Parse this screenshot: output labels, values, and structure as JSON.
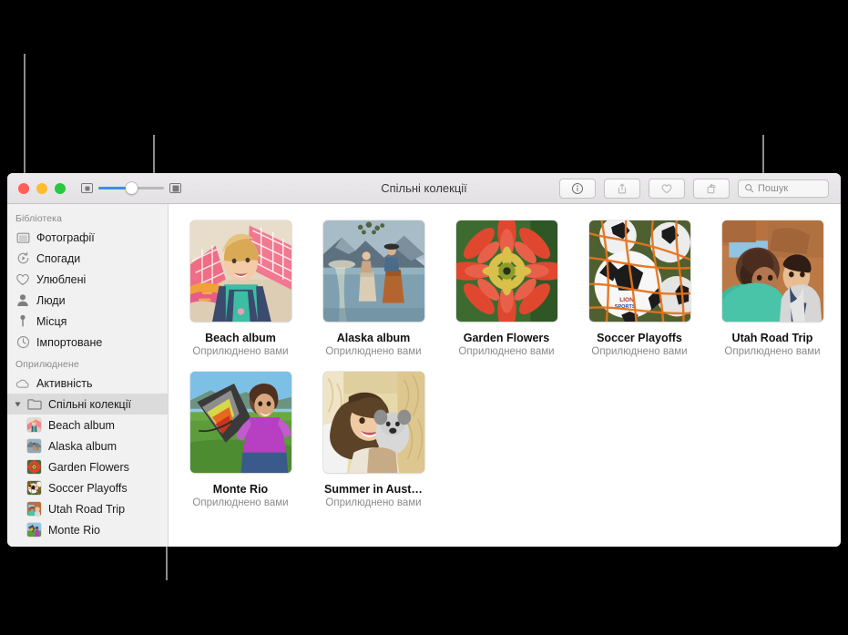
{
  "window": {
    "title": "Спільні колекції",
    "traffic_lights": [
      "close",
      "minimize",
      "zoom"
    ],
    "zoom_slider": {
      "min_icon": "small-thumbnail-icon",
      "max_icon": "large-thumbnail-icon",
      "value_percent": 46
    },
    "toolbar_buttons": [
      {
        "name": "info-button",
        "icon": "info-circle-icon"
      },
      {
        "name": "share-button",
        "icon": "share-up-arrow-icon"
      },
      {
        "name": "favorite-button",
        "icon": "heart-icon"
      },
      {
        "name": "rotate-button",
        "icon": "rotate-icon"
      }
    ],
    "search": {
      "placeholder": "Пошук",
      "icon": "search-icon"
    }
  },
  "sidebar": {
    "sections": [
      {
        "header": "Бібліотека",
        "items": [
          {
            "label": "Фотографії",
            "icon": "photos-icon"
          },
          {
            "label": "Спогади",
            "icon": "memories-icon"
          },
          {
            "label": "Улюблені",
            "icon": "heart-icon"
          },
          {
            "label": "Люди",
            "icon": "person-icon"
          },
          {
            "label": "Місця",
            "icon": "map-pin-icon"
          },
          {
            "label": "Імпортоване",
            "icon": "clock-icon"
          }
        ]
      },
      {
        "header": "Оприлюднене",
        "items": [
          {
            "label": "Активність",
            "icon": "cloud-icon",
            "selected": false
          },
          {
            "label": "Спільні колекції",
            "icon": "folder-icon",
            "selected": true,
            "disclosure": "open"
          }
        ],
        "children": [
          {
            "label": "Beach album",
            "icon": "album-thumbnail-beach"
          },
          {
            "label": "Alaska album",
            "icon": "album-thumbnail-alaska"
          },
          {
            "label": "Garden Flowers",
            "icon": "album-thumbnail-garden"
          },
          {
            "label": "Soccer Playoffs",
            "icon": "album-thumbnail-soccer"
          },
          {
            "label": "Utah Road Trip",
            "icon": "album-thumbnail-utah"
          },
          {
            "label": "Monte Rio",
            "icon": "album-thumbnail-monterio"
          }
        ]
      }
    ]
  },
  "main": {
    "albums": [
      {
        "title": "Beach album",
        "subtitle": "Оприлюднено вами",
        "art": "beach"
      },
      {
        "title": "Alaska album",
        "subtitle": "Оприлюднено вами",
        "art": "alaska"
      },
      {
        "title": "Garden Flowers",
        "subtitle": "Оприлюднено вами",
        "art": "garden"
      },
      {
        "title": "Soccer Playoffs",
        "subtitle": "Оприлюднено вами",
        "art": "soccer"
      },
      {
        "title": "Utah Road Trip",
        "subtitle": "Оприлюднено вами",
        "art": "utah"
      },
      {
        "title": "Monte Rio",
        "subtitle": "Оприлюднено вами",
        "art": "monterio"
      },
      {
        "title": "Summer in Aust…",
        "subtitle": "Оприлюднено вами",
        "art": "summer"
      }
    ]
  },
  "colors": {
    "accent": "#3b8cf5",
    "selection": "#dcdbdc",
    "sidebar_bg": "#f2f1f2",
    "titlebar_bg": "#e9e7e9",
    "callout_line": "#8c8c8c",
    "backdrop": "#000000"
  }
}
